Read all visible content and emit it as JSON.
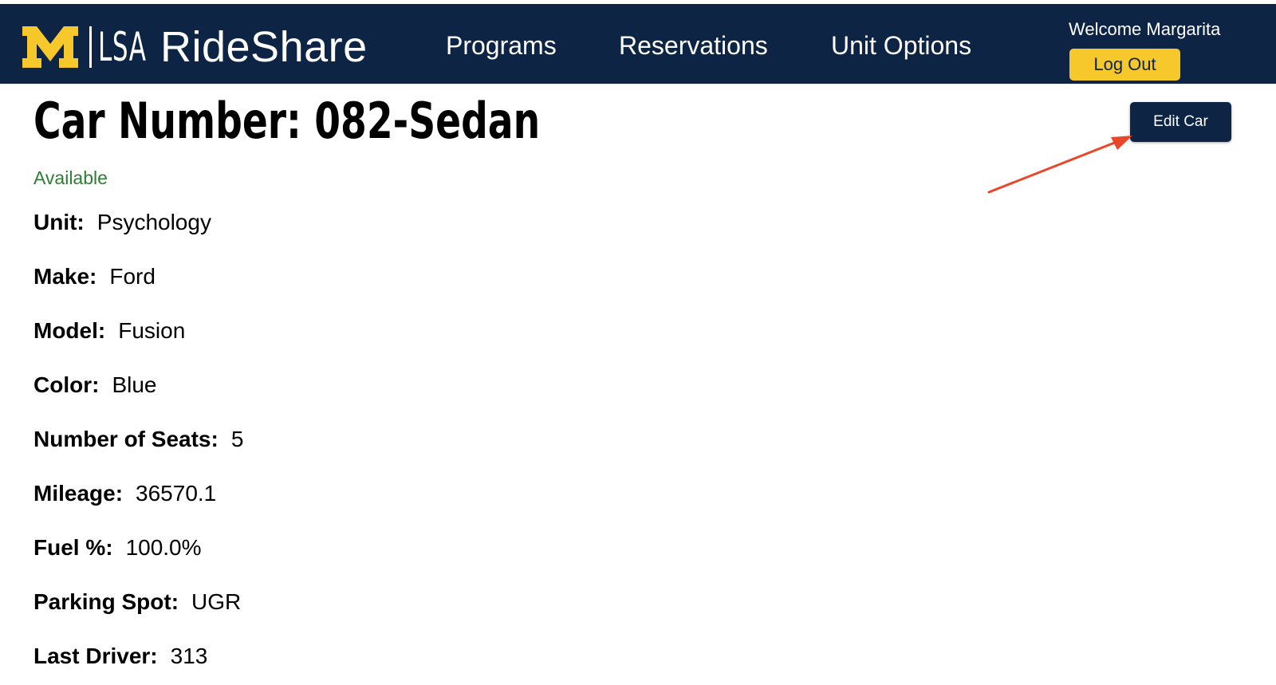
{
  "header": {
    "logo_letter": "M",
    "logo_dept": "LSA",
    "app_name": "RideShare",
    "nav": [
      {
        "label": "Programs"
      },
      {
        "label": "Reservations"
      },
      {
        "label": "Unit Options"
      }
    ],
    "welcome_text": "Welcome Margarita",
    "logout_label": "Log Out"
  },
  "car": {
    "title": "Car Number: 082-Sedan",
    "status": "Available",
    "edit_label": "Edit Car",
    "details": [
      {
        "label": "Unit:",
        "value": "Psychology"
      },
      {
        "label": "Make:",
        "value": "Ford"
      },
      {
        "label": "Model:",
        "value": "Fusion"
      },
      {
        "label": "Color:",
        "value": "Blue"
      },
      {
        "label": "Number of Seats:",
        "value": "5"
      },
      {
        "label": "Mileage:",
        "value": "36570.1"
      },
      {
        "label": "Fuel %:",
        "value": "100.0%"
      },
      {
        "label": "Parking Spot:",
        "value": "UGR"
      },
      {
        "label": "Last Driver:",
        "value": "313"
      }
    ]
  },
  "colors": {
    "navy": "#0d2444",
    "maize": "#f6c82b",
    "status_green": "#2e7d32",
    "annotation_red": "#e8472a"
  },
  "icons": {
    "logo": "block-m-logo",
    "annotation": "arrow-annotation"
  }
}
